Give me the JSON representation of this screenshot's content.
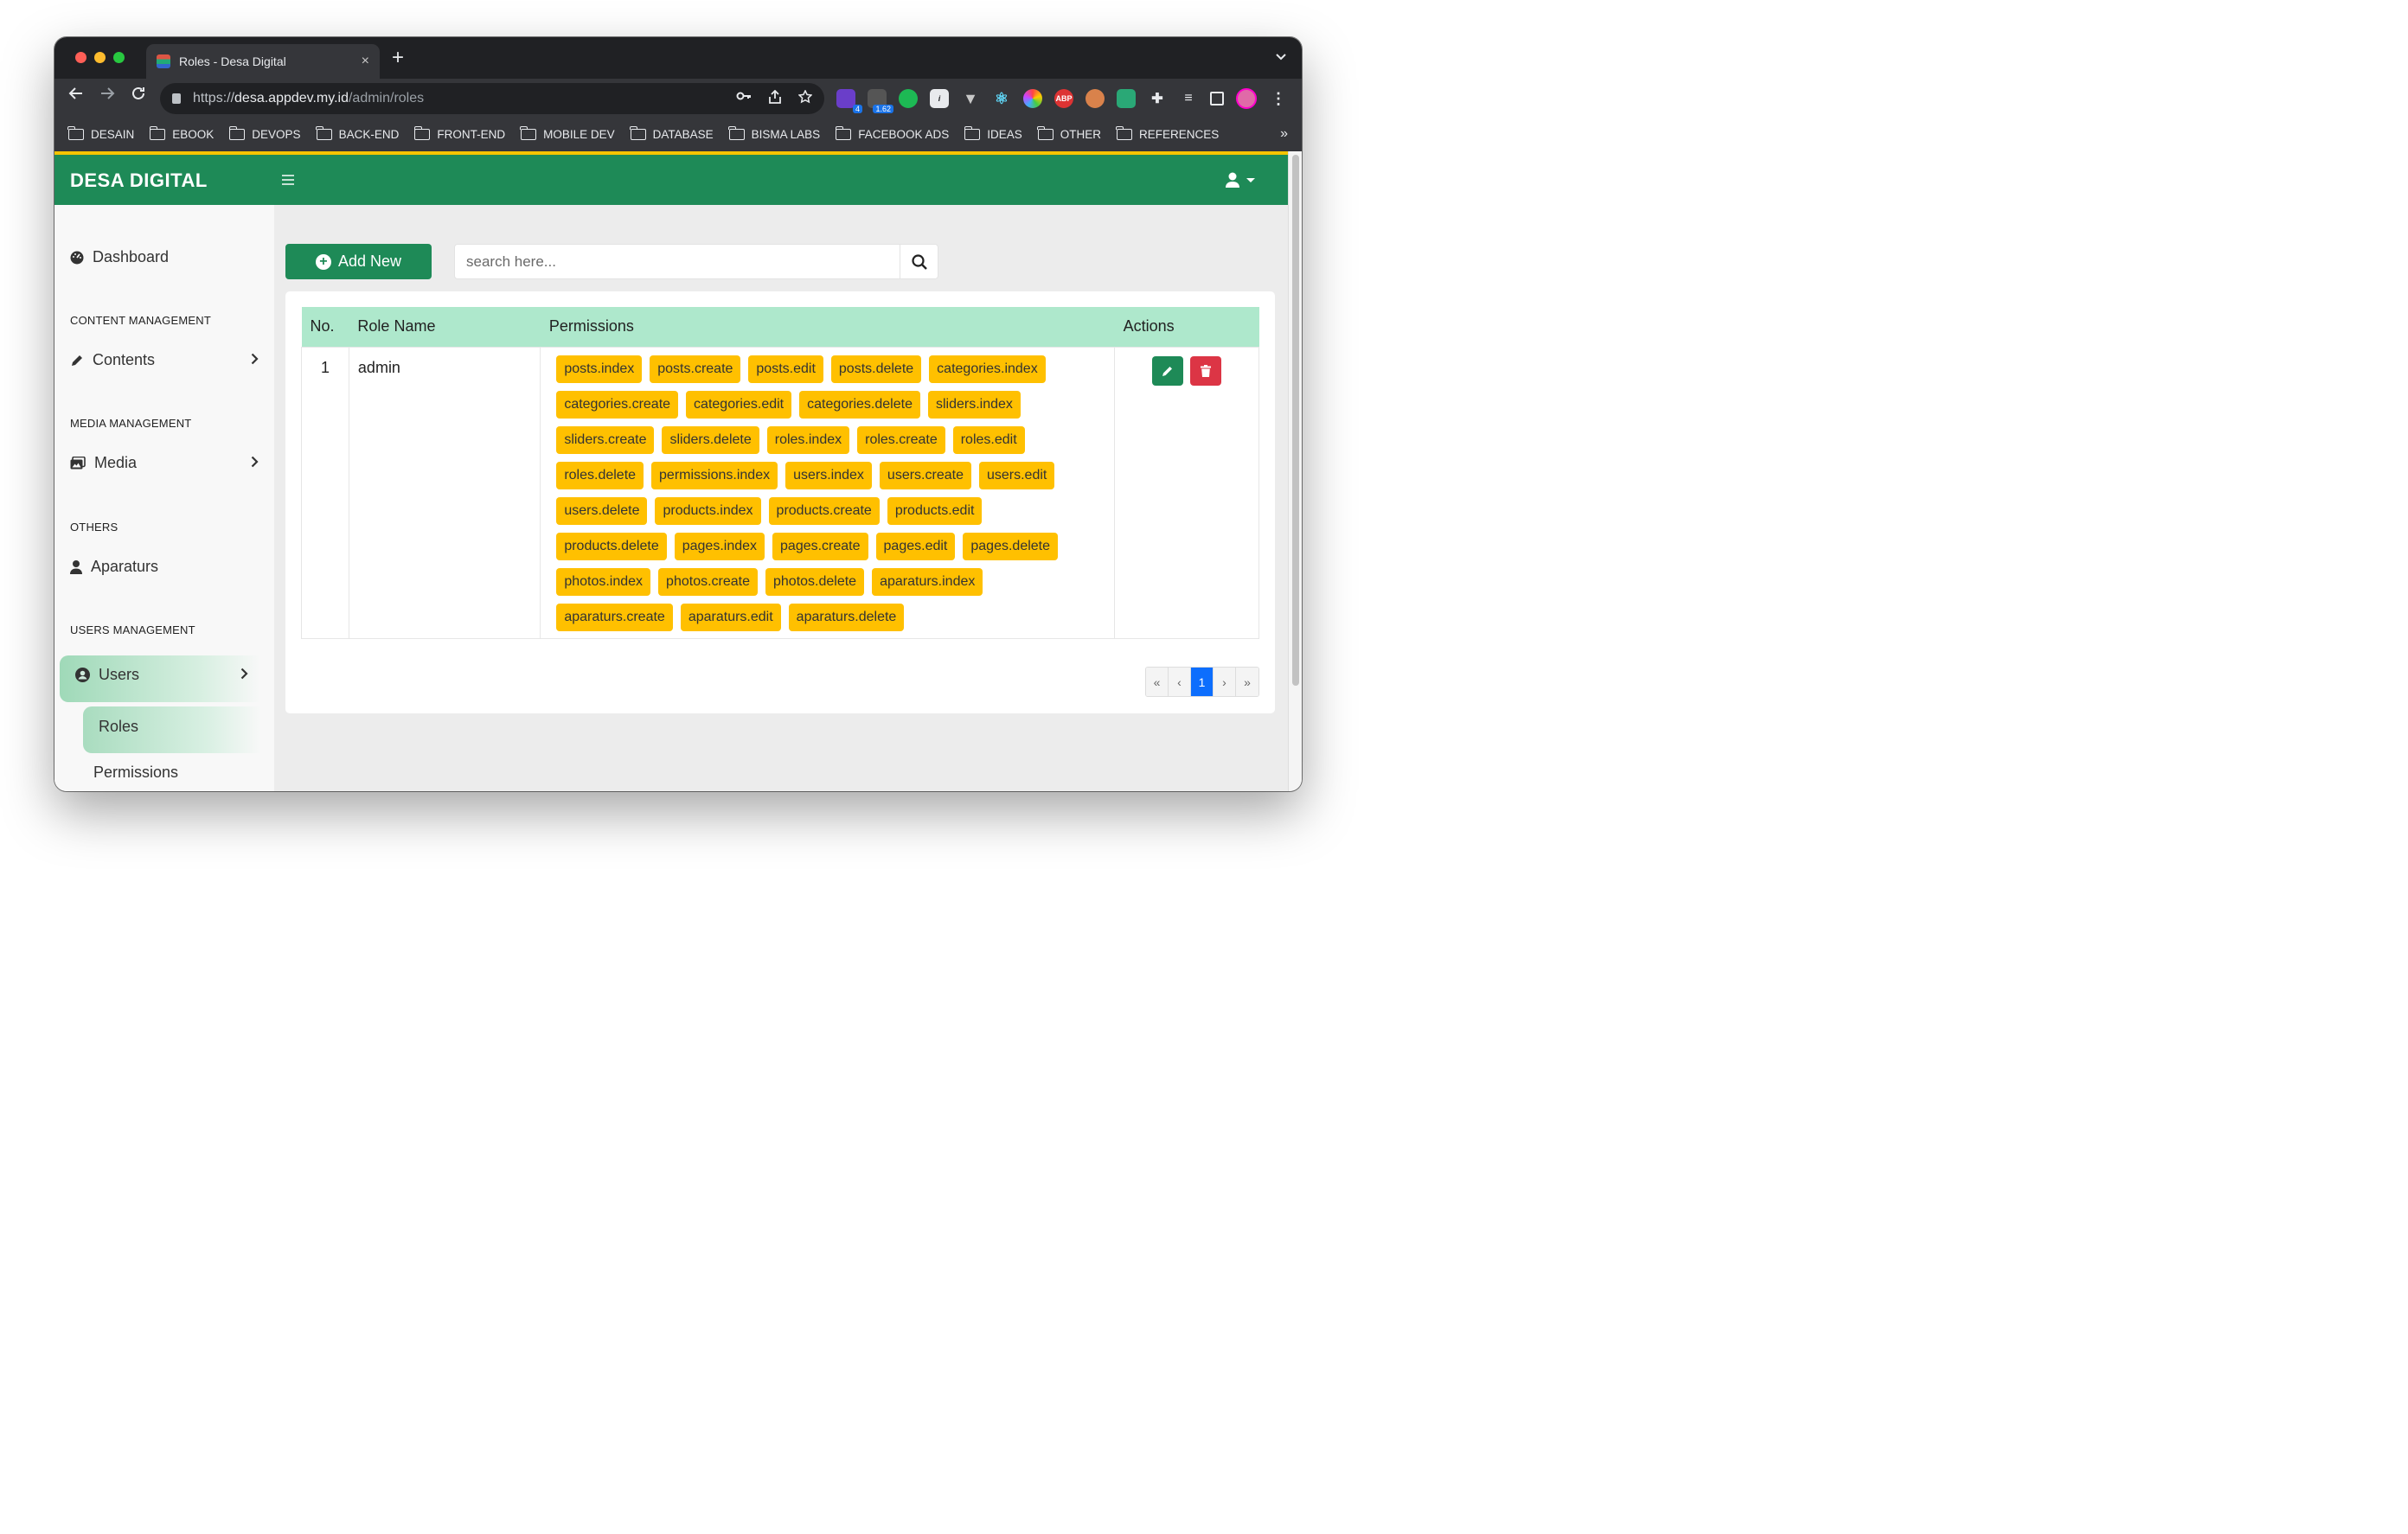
{
  "browser": {
    "tab_title": "Roles - Desa Digital",
    "tab_close": "×",
    "new_tab": "+",
    "url_scheme": "https://",
    "url_host": "desa.appdev.my.id",
    "url_path": "/admin/roles",
    "extension_badges": {
      "extension_2": "4",
      "extension_3": "1.62"
    },
    "bookmarks": [
      "DESAIN",
      "EBOOK",
      "DEVOPS",
      "BACK-END",
      "FRONT-END",
      "MOBILE DEV",
      "DATABASE",
      "BISMA LABS",
      "FACEBOOK ADS",
      "IDEAS",
      "OTHER",
      "REFERENCES"
    ],
    "bookmarks_more": "»"
  },
  "app": {
    "brand": "DESA DIGITAL",
    "colors": {
      "primary": "#1e8a57",
      "accent": "#f5c400",
      "badge": "#ffc000",
      "danger": "#dc3545",
      "table_header": "#aee8cc",
      "page_active": "#0d6efd"
    }
  },
  "sidebar": {
    "dashboard": "Dashboard",
    "content_heading": "CONTENT MANAGEMENT",
    "contents": "Contents",
    "media_heading": "MEDIA MANAGEMENT",
    "media": "Media",
    "others_heading": "OTHERS",
    "aparaturs": "Aparaturs",
    "users_heading": "USERS MANAGEMENT",
    "users": "Users",
    "roles": "Roles",
    "permissions": "Permissions"
  },
  "toolbar": {
    "add_label": "Add New",
    "search_placeholder": "search here..."
  },
  "table": {
    "headers": {
      "no": "No.",
      "role": "Role Name",
      "permissions": "Permissions",
      "actions": "Actions"
    },
    "rows": [
      {
        "no": "1",
        "role": "admin",
        "permissions": [
          "posts.index",
          "posts.create",
          "posts.edit",
          "posts.delete",
          "categories.index",
          "categories.create",
          "categories.edit",
          "categories.delete",
          "sliders.index",
          "sliders.create",
          "sliders.delete",
          "roles.index",
          "roles.create",
          "roles.edit",
          "roles.delete",
          "permissions.index",
          "users.index",
          "users.create",
          "users.edit",
          "users.delete",
          "products.index",
          "products.create",
          "products.edit",
          "products.delete",
          "pages.index",
          "pages.create",
          "pages.edit",
          "pages.delete",
          "photos.index",
          "photos.create",
          "photos.delete",
          "aparaturs.index",
          "aparaturs.create",
          "aparaturs.edit",
          "aparaturs.delete"
        ]
      }
    ]
  },
  "pagination": {
    "first": "«",
    "prev": "‹",
    "current": "1",
    "next": "›",
    "last": "»"
  }
}
